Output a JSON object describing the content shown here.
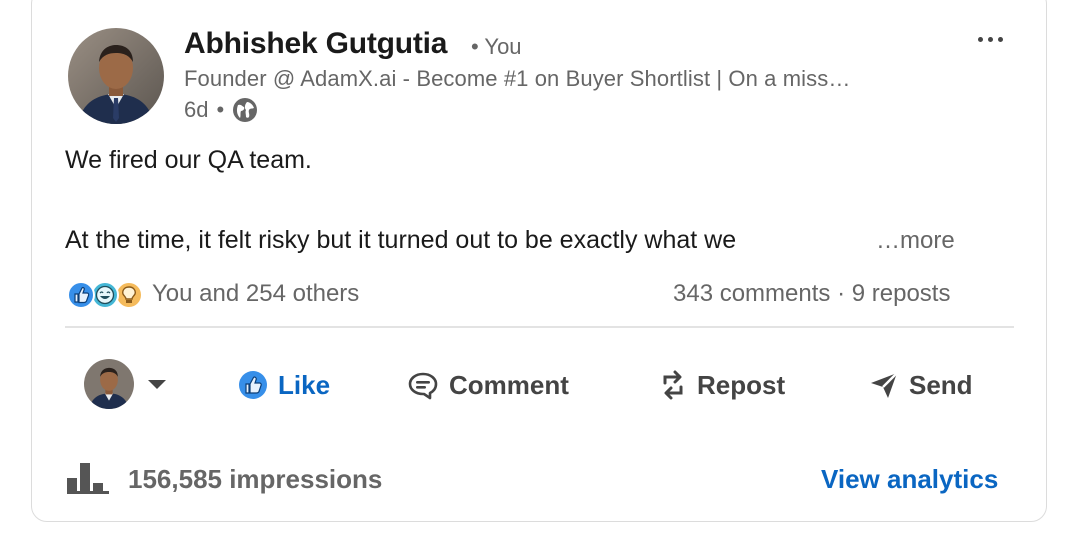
{
  "post": {
    "author": {
      "name": "Abhishek Gutgutia",
      "connection": "• You",
      "headline": "Founder @ AdamX.ai - Become #1 on Buyer Shortlist | On a miss…",
      "time": "6d",
      "visibility_sep": "•",
      "avatar_icon": "profile-photo"
    },
    "body": {
      "line1": "We fired our QA team.",
      "line2": "At the time, it felt risky but it turned out to be exactly what we",
      "see_more": "…more"
    },
    "social": {
      "reaction_icons": [
        "like-icon",
        "funny-icon",
        "insightful-icon"
      ],
      "reactions_text": "You and 254 others",
      "comments_text": "343 comments",
      "sep": "·",
      "reposts_text": "9 reposts"
    },
    "actions": {
      "like": "Like",
      "comment": "Comment",
      "repost": "Repost",
      "send": "Send"
    },
    "footer": {
      "impressions": "156,585 impressions",
      "analytics": "View analytics"
    }
  },
  "colors": {
    "accent": "#0a66c2",
    "muted": "#666666",
    "text": "#1a1a1a"
  }
}
